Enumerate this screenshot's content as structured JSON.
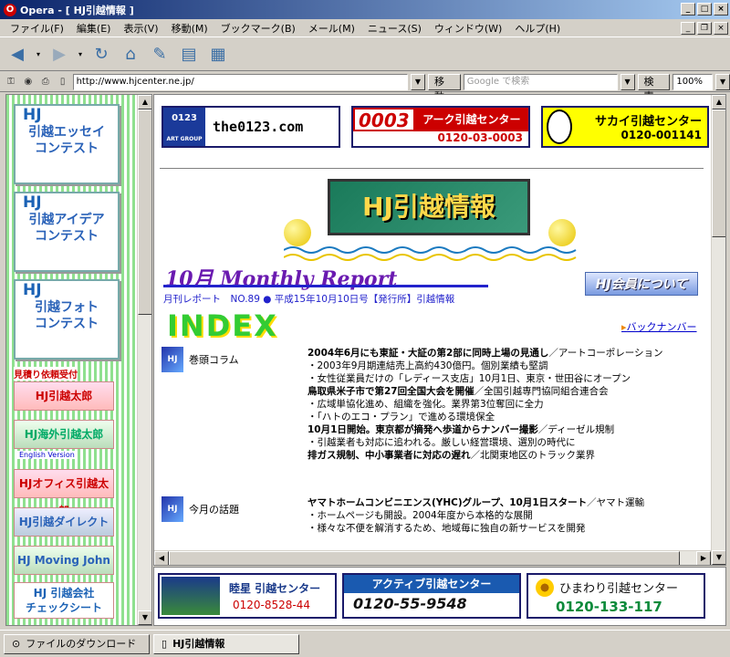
{
  "window": {
    "app": "Opera",
    "title": "Opera - [ HJ引越情報 ]"
  },
  "menu": [
    "ファイル(F)",
    "編集(E)",
    "表示(V)",
    "移動(M)",
    "ブックマーク(B)",
    "メール(M)",
    "ニュース(S)",
    "ウィンドウ(W)",
    "ヘルプ(H)"
  ],
  "address": {
    "url": "http://www.hjcenter.ne.jp/",
    "go_label": "移動",
    "search_placeholder": "Google で検索",
    "search_label": "検索",
    "zoom": "100%"
  },
  "sidebar": {
    "contests": [
      {
        "hj": "HJ",
        "label": "引越エッセイ\nコンテスト"
      },
      {
        "hj": "HJ",
        "label": "引越アイデア\nコンテスト"
      },
      {
        "hj": "HJ",
        "label": "引越フォト\nコンテスト"
      }
    ],
    "estimate_label": "見積り依頼受付",
    "services": [
      "HJ引越太郎",
      "HJ海外引越太郎",
      "HJオフィス引越太郎",
      "HJ引越ダイレクト",
      "HJ Moving John",
      "HJ 引越会社\nチェックシート"
    ],
    "english_label": "English Version"
  },
  "main": {
    "banners": [
      {
        "logo": "0123",
        "text": "the0123.com",
        "sub": "ART GROUP"
      },
      {
        "logo": "0003",
        "text": "アーク引越センター",
        "phone": "0120-03-0003"
      },
      {
        "text": "サカイ引越センター",
        "phone": "0120-001141"
      }
    ],
    "logo_title": "HJ引越情報",
    "report_title": "10月 Monthly Report",
    "report_sub": "月刊レポート　NO.89 ● 平成15年10月10日号【発行所】引越情報",
    "member_label": "HJ会員について",
    "index_title": "INDEX",
    "back_numbers": "バックナンバー",
    "sections": [
      {
        "label": "巻頭コラム",
        "lines": [
          {
            "bold": "2004年6月にも東証・大証の第2部に同時上場の見通し",
            "rest": "／アートコーポレーション"
          },
          {
            "bold": "",
            "rest": "・2003年9月期連結売上高約430億円。個別業績も堅調"
          },
          {
            "bold": "",
            "rest": "・女性従業員だけの「レディース支店」10月1日、東京・世田谷にオープン"
          },
          {
            "bold": "鳥取県米子市で第27回全国大会を開催",
            "rest": "／全国引越専門協同組合連合会"
          },
          {
            "bold": "",
            "rest": "・広域単協化進め、組織を強化。業界第3位奪回に全力"
          },
          {
            "bold": "",
            "rest": "・「ハトのエコ・プラン」で進める環境保全"
          },
          {
            "bold": "10月1日開始。東京都が摘発へ歩道からナンバー撮影",
            "rest": "／ディーゼル規制"
          },
          {
            "bold": "",
            "rest": "・引越業者も対応に追われる。厳しい経営環境、選別の時代に"
          },
          {
            "bold": "排ガス規制、中小事業者に対応の遅れ",
            "rest": "／北関東地区のトラック業界"
          }
        ]
      },
      {
        "label": "今月の話題",
        "lines": [
          {
            "bold": "ヤマトホームコンビニエンス(YHC)グループ、10月1日スタート",
            "rest": "／ヤマト運輸"
          },
          {
            "bold": "",
            "rest": "・ホームページも開設。2004年度から本格的な展開"
          },
          {
            "bold": "",
            "rest": "・様々な不便を解消するため、地域毎に独自の新サービスを開発"
          }
        ]
      }
    ]
  },
  "bottom_banners": [
    {
      "name": "睦星 引越センター",
      "phone": "0120-8528-44"
    },
    {
      "name": "アクティブ引越センター",
      "phone": "0120-55-9548"
    },
    {
      "name": "ひまわり引越センター",
      "phone": "0120-133-117"
    }
  ],
  "status": {
    "downloads": "ファイルのダウンロード",
    "tab": "HJ引越情報"
  }
}
